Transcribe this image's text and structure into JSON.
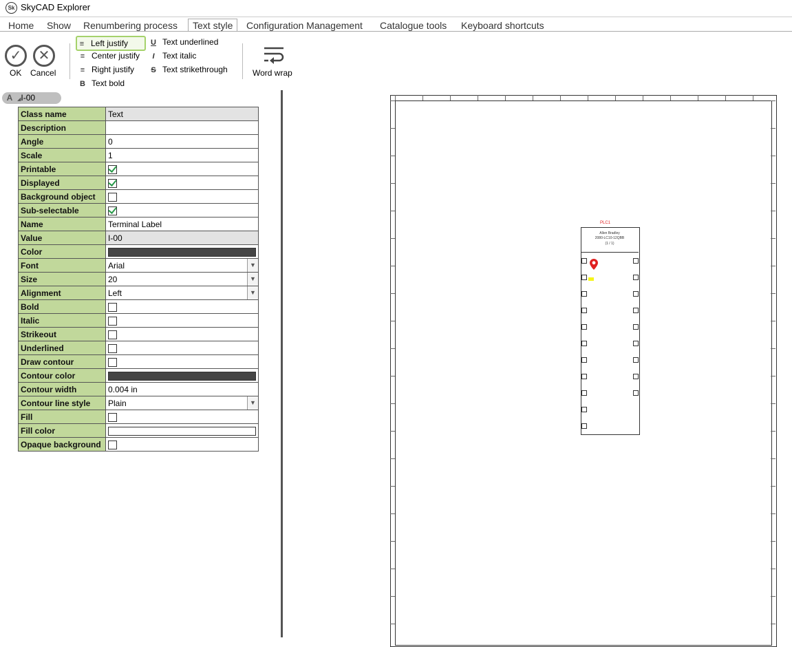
{
  "window": {
    "title": "SkyCAD Explorer",
    "logo_text": "Sk"
  },
  "menu": {
    "tabs": [
      "Home",
      "Show",
      "Renumbering process",
      "Text style",
      "Configuration Management",
      "Catalogue tools",
      "Keyboard shortcuts"
    ],
    "active_tab": "Text style"
  },
  "ribbon": {
    "ok_label": "OK",
    "cancel_label": "Cancel",
    "left_justify": "Left justify",
    "center_justify": "Center justify",
    "right_justify": "Right justify",
    "text_bold": "Text bold",
    "text_underlined": "Text underlined",
    "text_italic": "Text italic",
    "text_strikethrough": "Text strikethrough",
    "word_wrap": "Word wrap"
  },
  "object_chip": {
    "letter": "A",
    "label": "I-00"
  },
  "properties": {
    "class_name": {
      "key": "Class name",
      "value": "Text"
    },
    "description": {
      "key": "Description",
      "value": ""
    },
    "angle": {
      "key": "Angle",
      "value": "0"
    },
    "scale": {
      "key": "Scale",
      "value": "1"
    },
    "printable": {
      "key": "Printable",
      "checked": true
    },
    "displayed": {
      "key": "Displayed",
      "checked": true
    },
    "background_object": {
      "key": "Background object",
      "checked": false
    },
    "sub_selectable": {
      "key": "Sub-selectable",
      "checked": true
    },
    "name": {
      "key": "Name",
      "value": "Terminal Label"
    },
    "value": {
      "key": "Value",
      "value": "I-00"
    },
    "color": {
      "key": "Color",
      "swatch": "#454545"
    },
    "font": {
      "key": "Font",
      "value": "Arial"
    },
    "size": {
      "key": "Size",
      "value": "20"
    },
    "alignment": {
      "key": "Alignment",
      "value": "Left"
    },
    "bold": {
      "key": "Bold",
      "checked": false
    },
    "italic": {
      "key": "Italic",
      "checked": false
    },
    "strikeout": {
      "key": "Strikeout",
      "checked": false
    },
    "underlined": {
      "key": "Underlined",
      "checked": false
    },
    "draw_contour": {
      "key": "Draw contour",
      "checked": false
    },
    "contour_color": {
      "key": "Contour color",
      "swatch": "#454545"
    },
    "contour_width": {
      "key": "Contour width",
      "value": "0.004 in"
    },
    "contour_line_style": {
      "key": "Contour line style",
      "value": "Plain"
    },
    "fill": {
      "key": "Fill",
      "checked": false
    },
    "fill_color": {
      "key": "Fill color",
      "swatch": "#ffffff"
    },
    "opaque_background": {
      "key": "Opaque background",
      "checked": false
    }
  },
  "drawing": {
    "plc_tag": "PLC1",
    "plc_maker": "Allen Bradley",
    "plc_model": "2080-LC10-12QBB",
    "plc_page": "(1 / 1)",
    "accent": "#e02020",
    "highlight": "#f5f51a"
  }
}
